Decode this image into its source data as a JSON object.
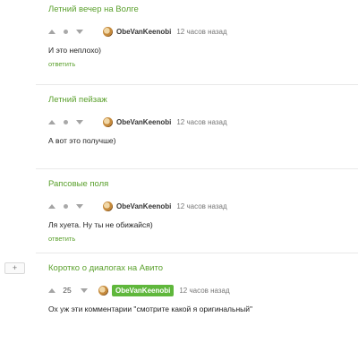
{
  "expand_label": "+",
  "comments": [
    {
      "post_title": "Летний вечер на Волге",
      "score": "",
      "author": "ObeVanKeenobi",
      "time": "12 часов назад",
      "text": "И это неплохо)",
      "reply": "ответить"
    },
    {
      "post_title": "Летний пейзаж",
      "score": "",
      "author": "ObeVanKeenobi",
      "time": "12 часов назад",
      "text": "А вот это получше)",
      "reply": "ответить"
    },
    {
      "post_title": "Рапсовые поля",
      "score": "",
      "author": "ObeVanKeenobi",
      "time": "12 часов назад",
      "text": "Ля хуета. Ну ты не обижайся)",
      "reply": "ответить"
    },
    {
      "post_title": "Коротко о диалогах на Авито",
      "score": "25",
      "author": "ObeVanKeenobi",
      "time": "12 часов назад",
      "text": "Ох уж эти комментарии \"смотрите какой я оригинальный\"",
      "reply": "ответить"
    }
  ]
}
